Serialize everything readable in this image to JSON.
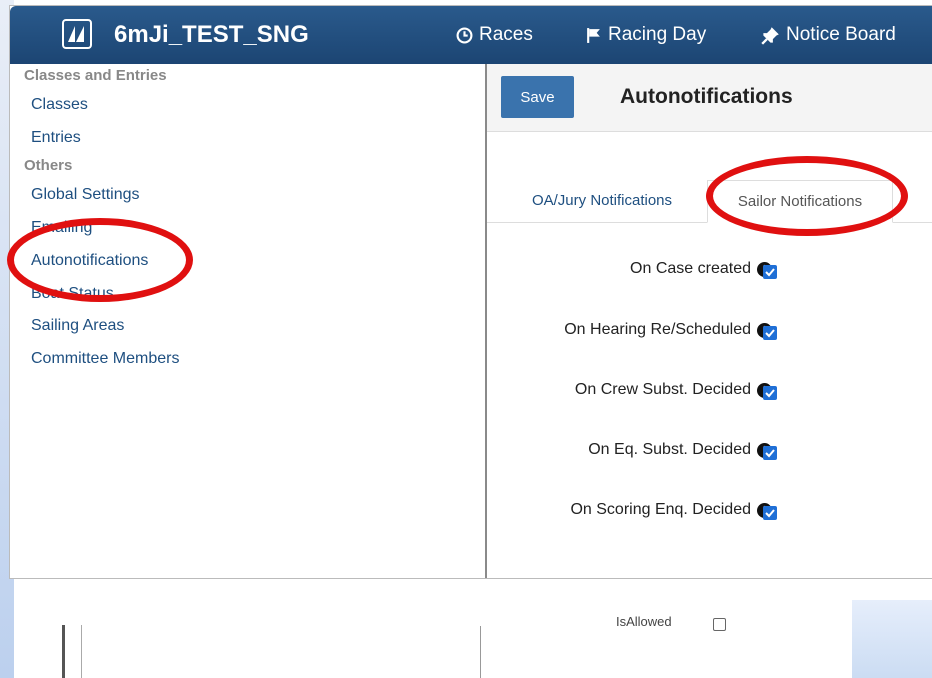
{
  "app": {
    "title": "6mJi_TEST_SNG"
  },
  "nav": {
    "races": "Races",
    "racing_day": "Racing Day",
    "notice_board": "Notice Board"
  },
  "sidebar": {
    "header_classes": "Classes and Entries",
    "classes": "Classes",
    "entries": "Entries",
    "header_others": "Others",
    "global_settings": "Global Settings",
    "emailing": "Emailing",
    "autonotifications": "Autonotifications",
    "boat_status": "Boat Status",
    "sailing_areas": "Sailing Areas",
    "committee_members": "Committee Members"
  },
  "toolbar": {
    "save_label": "Save",
    "title": "Autonotifications"
  },
  "tabs": [
    {
      "label": "OA/Jury Notifications",
      "active": false
    },
    {
      "label": "Sailor Notifications",
      "active": true
    }
  ],
  "settings": [
    {
      "label": "On Case created",
      "checked": true
    },
    {
      "label": "On Hearing Re/Scheduled",
      "checked": true
    },
    {
      "label": "On Crew Subst. Decided",
      "checked": true
    },
    {
      "label": "On Eq. Subst. Decided",
      "checked": true
    },
    {
      "label": "On Scoring Enq. Decided",
      "checked": true
    }
  ],
  "background": {
    "partial_label": "IsAllowed"
  },
  "colors": {
    "navbar": "#1c4573",
    "link": "#1e4f80",
    "accent": "#3a73ad",
    "annotation": "#e01010"
  }
}
